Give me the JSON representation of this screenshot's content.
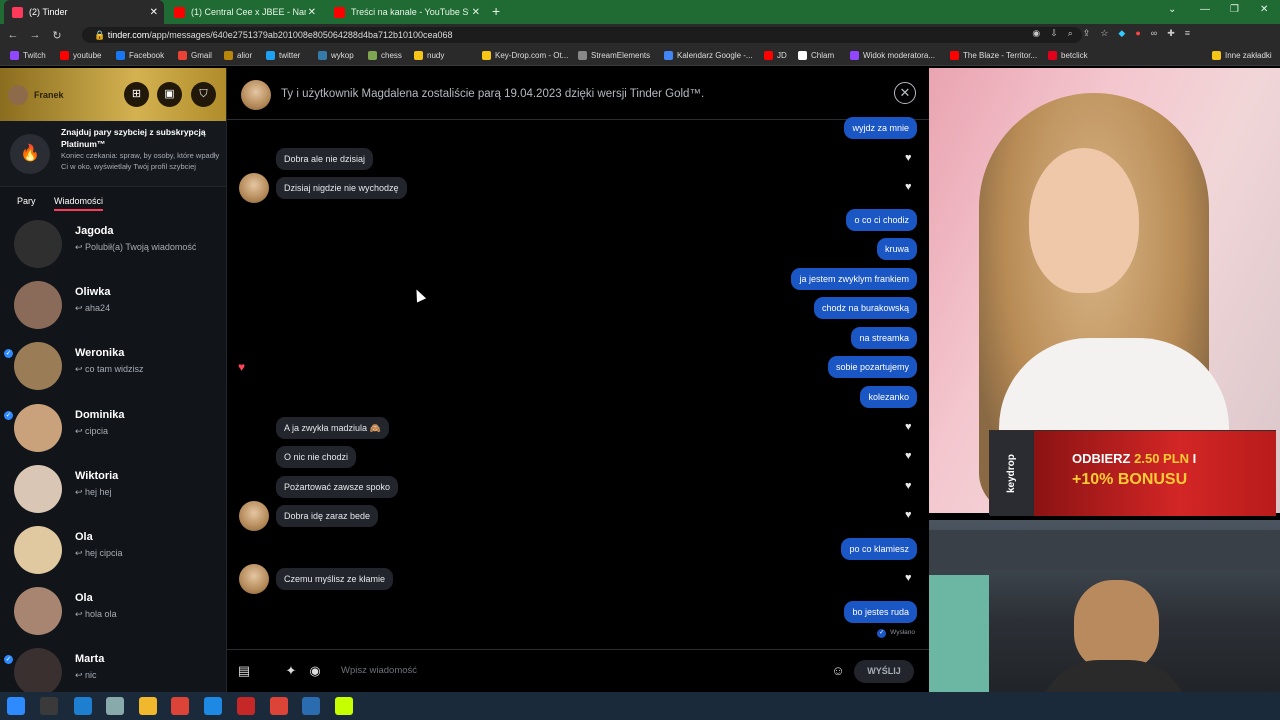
{
  "browser": {
    "tabs": [
      {
        "label": "(2) Tinder",
        "color": "#fd3a5a"
      },
      {
        "label": "(1) Central Cee x JBEE - Name Of",
        "color": "#ff0000"
      },
      {
        "label": "Treści na kanale - YouTube Studio",
        "color": "#ff0000"
      }
    ],
    "url_host": "tinder.com",
    "url_path": "/app/messages/640e2751379ab201008e805064288d4ba712b10100cea068",
    "bookmarks": [
      "Twitch",
      "youtube",
      "Facebook",
      "Gmail",
      "alior",
      "twitter",
      "wykop",
      "chess",
      "nudy",
      "Key-Drop.com - Ot...",
      "StreamElements",
      "Kalendarz Google -...",
      "JD",
      "Chlam",
      "Widok moderatora...",
      "The Blaze - Territor...",
      "betclick",
      "Inne zakładki"
    ]
  },
  "sidebar": {
    "user_name": "Franek",
    "promo_title": "Znajduj pary szybciej z subskrypcją Platinum™",
    "promo_sub": "Koniec czekania: spraw, by osoby, które wpadły Ci w oko, wyświetlały Twój profil szybciej",
    "tab_matches": "Pary",
    "tab_messages": "Wiadomości",
    "contacts": [
      {
        "name": "Jagoda",
        "msg": "↩ Polubił(a) Twoją wiadomość",
        "verified": false,
        "color": "#2f2f2f"
      },
      {
        "name": "Oliwka",
        "msg": "↩ aha24",
        "verified": false,
        "color": "#8a6a58"
      },
      {
        "name": "Weronika",
        "msg": "↩ co tam widzisz",
        "verified": true,
        "color": "#9a7c56"
      },
      {
        "name": "Dominika",
        "msg": "↩ cipcia",
        "verified": true,
        "color": "#c9a27c"
      },
      {
        "name": "Wiktoria",
        "msg": "↩ hej hej",
        "verified": false,
        "color": "#d9c6b4"
      },
      {
        "name": "Ola",
        "msg": "↩ hej cipcia",
        "verified": false,
        "color": "#e0c8a0"
      },
      {
        "name": "Ola",
        "msg": "↩ hola ola",
        "verified": false,
        "color": "#a88570"
      },
      {
        "name": "Marta",
        "msg": "↩ nic",
        "verified": true,
        "color": "#3a3030"
      }
    ]
  },
  "chat": {
    "header": "Ty i użytkownik Magdalena zostaliście parą 19.04.2023 dzięki wersji Tinder Gold™.",
    "messages": [
      {
        "text": "wyjdz za mnie",
        "dir": "out"
      },
      {
        "text": "Dobra ale nie dzisiaj",
        "dir": "in"
      },
      {
        "text": "Dzisiaj nigdzie nie wychodzę",
        "dir": "in"
      },
      {
        "text": "o co ci chodiz",
        "dir": "out"
      },
      {
        "text": "kruwa",
        "dir": "out"
      },
      {
        "text": "ja jestem zwyklym frankiem",
        "dir": "out"
      },
      {
        "text": "chodz na burakowską",
        "dir": "out"
      },
      {
        "text": "na streamka",
        "dir": "out"
      },
      {
        "text": "sobie pozartujemy",
        "dir": "out"
      },
      {
        "text": "kolezanko",
        "dir": "out"
      },
      {
        "text": "A ja zwykła madziula 🙈",
        "dir": "in"
      },
      {
        "text": "O nic nie chodzi",
        "dir": "in"
      },
      {
        "text": "Pożartować zawsze spoko",
        "dir": "in"
      },
      {
        "text": "Dobra idę zaraz bede",
        "dir": "in"
      },
      {
        "text": "po co klamiesz",
        "dir": "out"
      },
      {
        "text": "Czemu myślisz ze kłamie",
        "dir": "in"
      },
      {
        "text": "bo jestes ruda",
        "dir": "out"
      }
    ],
    "sent_status": "Wysłano",
    "input_placeholder": "Wpisz wiadomość",
    "send_label": "WYŚLIJ"
  },
  "ad": {
    "brand": "keydrop",
    "line1_prefix": "ODBIERZ ",
    "line1_amount": "2.50 PLN",
    "line1_suffix": " I",
    "line2": "+10% BONUSU"
  },
  "colors": {
    "tinder_red": "#fd3a5a",
    "outgoing": "#1a56c4",
    "incoming": "#22262c",
    "gold": "#d4b251"
  }
}
